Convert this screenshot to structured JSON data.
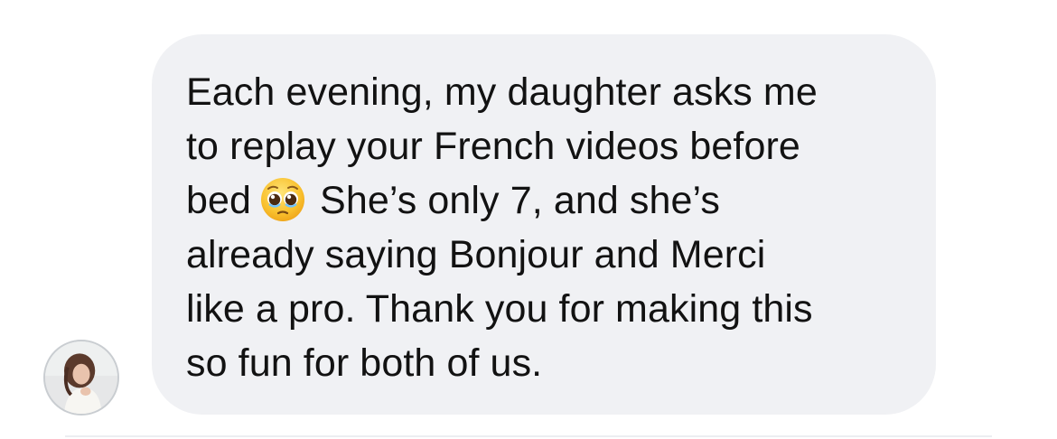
{
  "message": {
    "lines": [
      "Each evening, my daughter asks me",
      "to replay your French videos before",
      "bed",
      "She’s only 7, and she’s",
      "already saying Bonjour and Merci",
      "like a pro. Thank you for making this",
      "so fun for both of us."
    ],
    "emoji": "pleading-face-icon"
  },
  "colors": {
    "bubble": "#f0f1f4",
    "text": "#121212"
  }
}
